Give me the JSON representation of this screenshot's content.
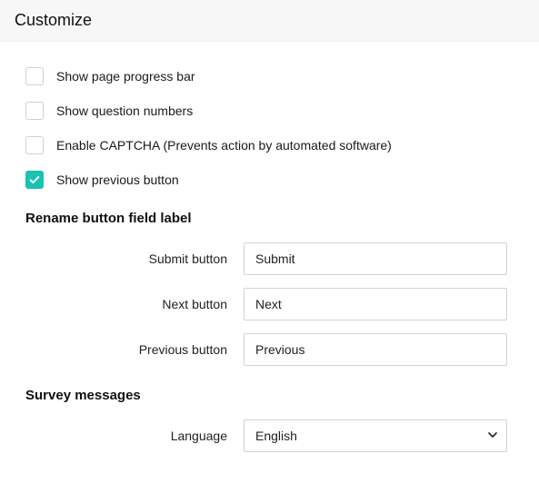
{
  "header": {
    "title": "Customize"
  },
  "options": [
    {
      "label": "Show page progress bar",
      "checked": false
    },
    {
      "label": "Show question numbers",
      "checked": false
    },
    {
      "label": "Enable CAPTCHA (Prevents action by automated software)",
      "checked": false
    },
    {
      "label": "Show previous button",
      "checked": true
    }
  ],
  "rename_section": {
    "heading": "Rename button field label",
    "fields": {
      "submit": {
        "label": "Submit button",
        "value": "Submit"
      },
      "next": {
        "label": "Next button",
        "value": "Next"
      },
      "previous": {
        "label": "Previous button",
        "value": "Previous"
      }
    }
  },
  "messages_section": {
    "heading": "Survey messages",
    "language": {
      "label": "Language",
      "value": "English"
    }
  }
}
